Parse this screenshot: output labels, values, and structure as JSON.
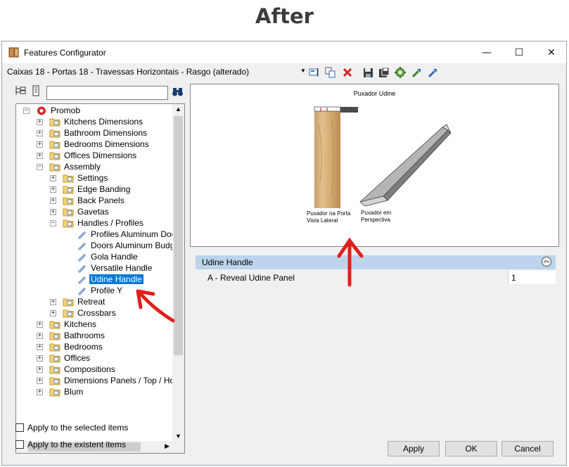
{
  "caption": "After",
  "window": {
    "title": "Features Configurator",
    "controls": {
      "minimize": "—",
      "maximize": "☐",
      "close": "✕"
    }
  },
  "toolbar": {
    "combo_value": "Caixas 18 - Portas 18 - Travessas Horizontais - Rasgo (alterado)",
    "icons": [
      "edit-icon",
      "copy-icon",
      "delete-icon",
      "save-icon",
      "save-as-icon",
      "settings-icon",
      "export-icon",
      "import-icon"
    ]
  },
  "tree": {
    "items": [
      {
        "label": "Promob"
      },
      {
        "label": "Kitchens Dimensions"
      },
      {
        "label": "Bathroom Dimensions"
      },
      {
        "label": "Bedrooms Dimensions"
      },
      {
        "label": "Offices Dimensions"
      },
      {
        "label": "Assembly"
      },
      {
        "label": "Settings"
      },
      {
        "label": "Edge Banding"
      },
      {
        "label": "Back Panels"
      },
      {
        "label": "Gavetas"
      },
      {
        "label": "Handles / Profiles"
      },
      {
        "label": "Profiles Aluminum Doors"
      },
      {
        "label": "Doors Aluminum Budget"
      },
      {
        "label": "Gola Handle"
      },
      {
        "label": "Versatile Handle"
      },
      {
        "label": "Udine Handle"
      },
      {
        "label": "Profile Y"
      },
      {
        "label": "Retreat"
      },
      {
        "label": "Crossbars"
      },
      {
        "label": "Kitchens"
      },
      {
        "label": "Bathrooms"
      },
      {
        "label": "Bedrooms"
      },
      {
        "label": "Offices"
      },
      {
        "label": "Compositions"
      },
      {
        "label": "Dimensions Panels / Top / Honey"
      },
      {
        "label": "Blum"
      }
    ],
    "selected": "Udine Handle"
  },
  "preview": {
    "title": "Puxador Udine",
    "label_left": [
      "Puxador na Porta",
      "Vista Lateral"
    ],
    "label_right": [
      "Puxador em",
      "Perspectiva"
    ]
  },
  "properties": {
    "group": "Udine Handle",
    "rows": [
      {
        "name": "A - Reveal Udine Panel",
        "value": "1"
      }
    ]
  },
  "options": {
    "apply_selected": "Apply to the selected items",
    "apply_existent": "Apply to the existent items"
  },
  "buttons": {
    "apply": "Apply",
    "ok": "OK",
    "cancel": "Cancel"
  },
  "colors": {
    "selection": "#0078d7",
    "annotation_arrow": "#e0201b",
    "group_header": "#bcd4ec"
  }
}
